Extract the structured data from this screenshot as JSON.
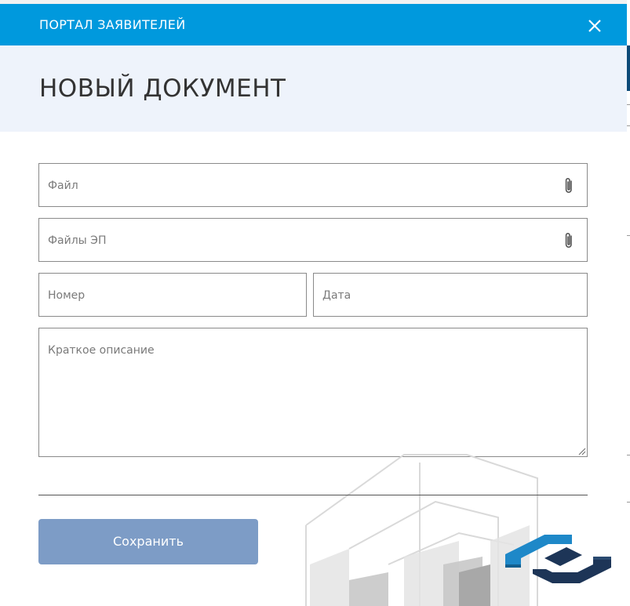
{
  "header": {
    "title": "ПОРТАЛ ЗАЯВИТЕЛЕЙ",
    "close_icon": "close-icon"
  },
  "page": {
    "title": "НОВЫЙ ДОКУМЕНТ"
  },
  "form": {
    "file_placeholder": "Файл",
    "ep_files_placeholder": "Файлы ЭП",
    "number_placeholder": "Номер",
    "date_placeholder": "Дата",
    "description_placeholder": "Краткое описание",
    "attach_icon": "paperclip-icon"
  },
  "actions": {
    "save_label": "Сохранить"
  },
  "colors": {
    "header_bg": "#0099dd",
    "title_band_bg": "#eef3fb",
    "save_button_bg": "#7d9cc6",
    "logo_light": "#1e88c8",
    "logo_dark": "#1d3557"
  }
}
